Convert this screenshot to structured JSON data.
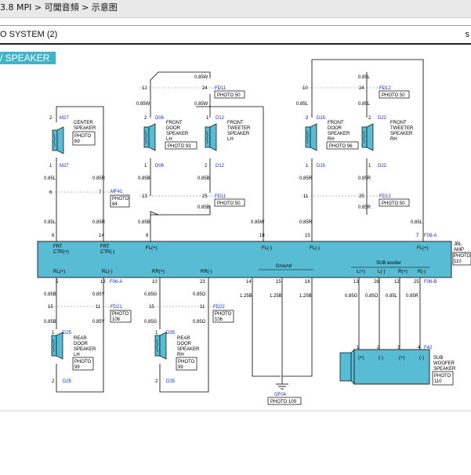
{
  "breadcrumb": "3.8 MPI > 可聞音頻 > 示意图",
  "section_title": "O SYSTEM (2)",
  "section_mark": "s",
  "subsection_tag": "/ SPEAKER",
  "amp": {
    "label1": "JBL",
    "label2": "AMP",
    "photo": "PHOTO",
    "photo_no": "110",
    "conn_top": "F08-A",
    "conn_bottom": "F06-A",
    "conn_bottom2": "F06-B",
    "top_labels": [
      "FRT",
      "CTR(+)",
      "FRT",
      "CTR(-)",
      "FL(+)",
      "FL(-)",
      "FL(-)",
      "FL(+)"
    ],
    "bottom_labels": [
      "RL(+)",
      "RL(-)",
      "RR(+)",
      "RR(-)",
      "Ground",
      "SUB woofer",
      "L(+)",
      "L(-)",
      "R(+)",
      "R(-)"
    ]
  },
  "pins_top": [
    "6",
    "14",
    "8",
    "18",
    "15",
    "7"
  ],
  "pins_bottom": [
    "5",
    "13",
    "10",
    "23",
    "14",
    "15",
    "16",
    "13",
    "26",
    "12",
    "25"
  ],
  "wires": {
    "w085L": "0.85L",
    "w085R": "0.85R",
    "w085B": "0.85B",
    "w085W": "0.85W",
    "w085Y": "0.85Y",
    "w085G": "0.85G",
    "w085O": "0.85O",
    "w125B": "1.25B"
  },
  "connectors": {
    "m27": "M27",
    "mf41": "MF41",
    "d06": "D06",
    "d12": "D12",
    "fd11": "FD11",
    "d15": "D15",
    "d22": "D22",
    "fd12": "FD12",
    "d25": "D25",
    "fd21": "FD21",
    "d35": "D35",
    "fd22": "FD22",
    "f42": "F42",
    "gf04": "GF04"
  },
  "pin_nums": {
    "p1": "1",
    "p2": "2",
    "p3": "3",
    "p4": "4",
    "p6": "6",
    "p7": "7",
    "p10": "10",
    "p11": "11",
    "p12": "12",
    "p13": "13",
    "p15": "15",
    "p24": "24",
    "p25": "25"
  },
  "components": {
    "center": [
      "CENTER",
      "SPEAKER",
      "PHOTO",
      "69"
    ],
    "front_door_lh": [
      "FRONT",
      "DOOR",
      "SPEAKER",
      "LH",
      "PHOTO 93"
    ],
    "front_tweeter_lh": [
      "FRONT",
      "TWEETER",
      "SPEAKER",
      "LH"
    ],
    "front_door_rh": [
      "FRONT",
      "DOOR",
      "SPEAKER",
      "RH",
      "PHOTO 96"
    ],
    "front_tweeter_rh": [
      "FRONT",
      "TWEETER",
      "SPEAKER",
      "RH"
    ],
    "rear_door_lh": [
      "REAR",
      "DOOR",
      "SPEAKER",
      "LH",
      "PHOTO",
      "99"
    ],
    "rear_door_rh": [
      "REAR",
      "DOOR",
      "SPEAKER",
      "RH",
      "PHOTO",
      "99"
    ],
    "sub_woofer": [
      "SUB",
      "WOOFER",
      "SPEAKER",
      "PHOTO",
      "110"
    ]
  },
  "photos": {
    "p50": "PHOTO 50",
    "p84a": "PHOTO",
    "p84b": "84",
    "p106a": "PHOTO",
    "p106b": "106",
    "p109": "PHOTO 109"
  },
  "sub_pin_signs": [
    "(+)",
    "(-)",
    "(+)",
    "(-)"
  ],
  "colors": {
    "amp_fill": "#58bcd4",
    "tag_bg": "#40b4c8",
    "connector_blue": "#1a2bd6"
  }
}
